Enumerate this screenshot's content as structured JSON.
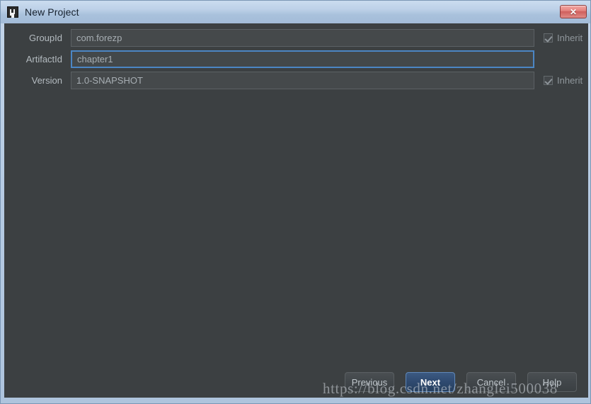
{
  "window": {
    "title": "New Project",
    "icon": "intellij-idea-icon",
    "close_label": "✕",
    "frame_color": "#b6cbe3",
    "content_bg": "#3c4042"
  },
  "form": {
    "rows": [
      {
        "label": "GroupId",
        "value": "com.forezp",
        "focused": false,
        "inherit": {
          "label": "Inherit",
          "checked": true,
          "enabled": false
        }
      },
      {
        "label": "ArtifactId",
        "value": "chapter1",
        "focused": true,
        "inherit": null
      },
      {
        "label": "Version",
        "value": "1.0-SNAPSHOT",
        "focused": false,
        "inherit": {
          "label": "Inherit",
          "checked": true,
          "enabled": false
        }
      }
    ]
  },
  "buttons": {
    "previous": "Previous",
    "next": "Next",
    "cancel": "Cancel",
    "help": "Help",
    "default_button": "Next",
    "default_color": "#2f4a70"
  },
  "watermark": {
    "text": "https://blog.csdn.net/zhanglei500038"
  }
}
